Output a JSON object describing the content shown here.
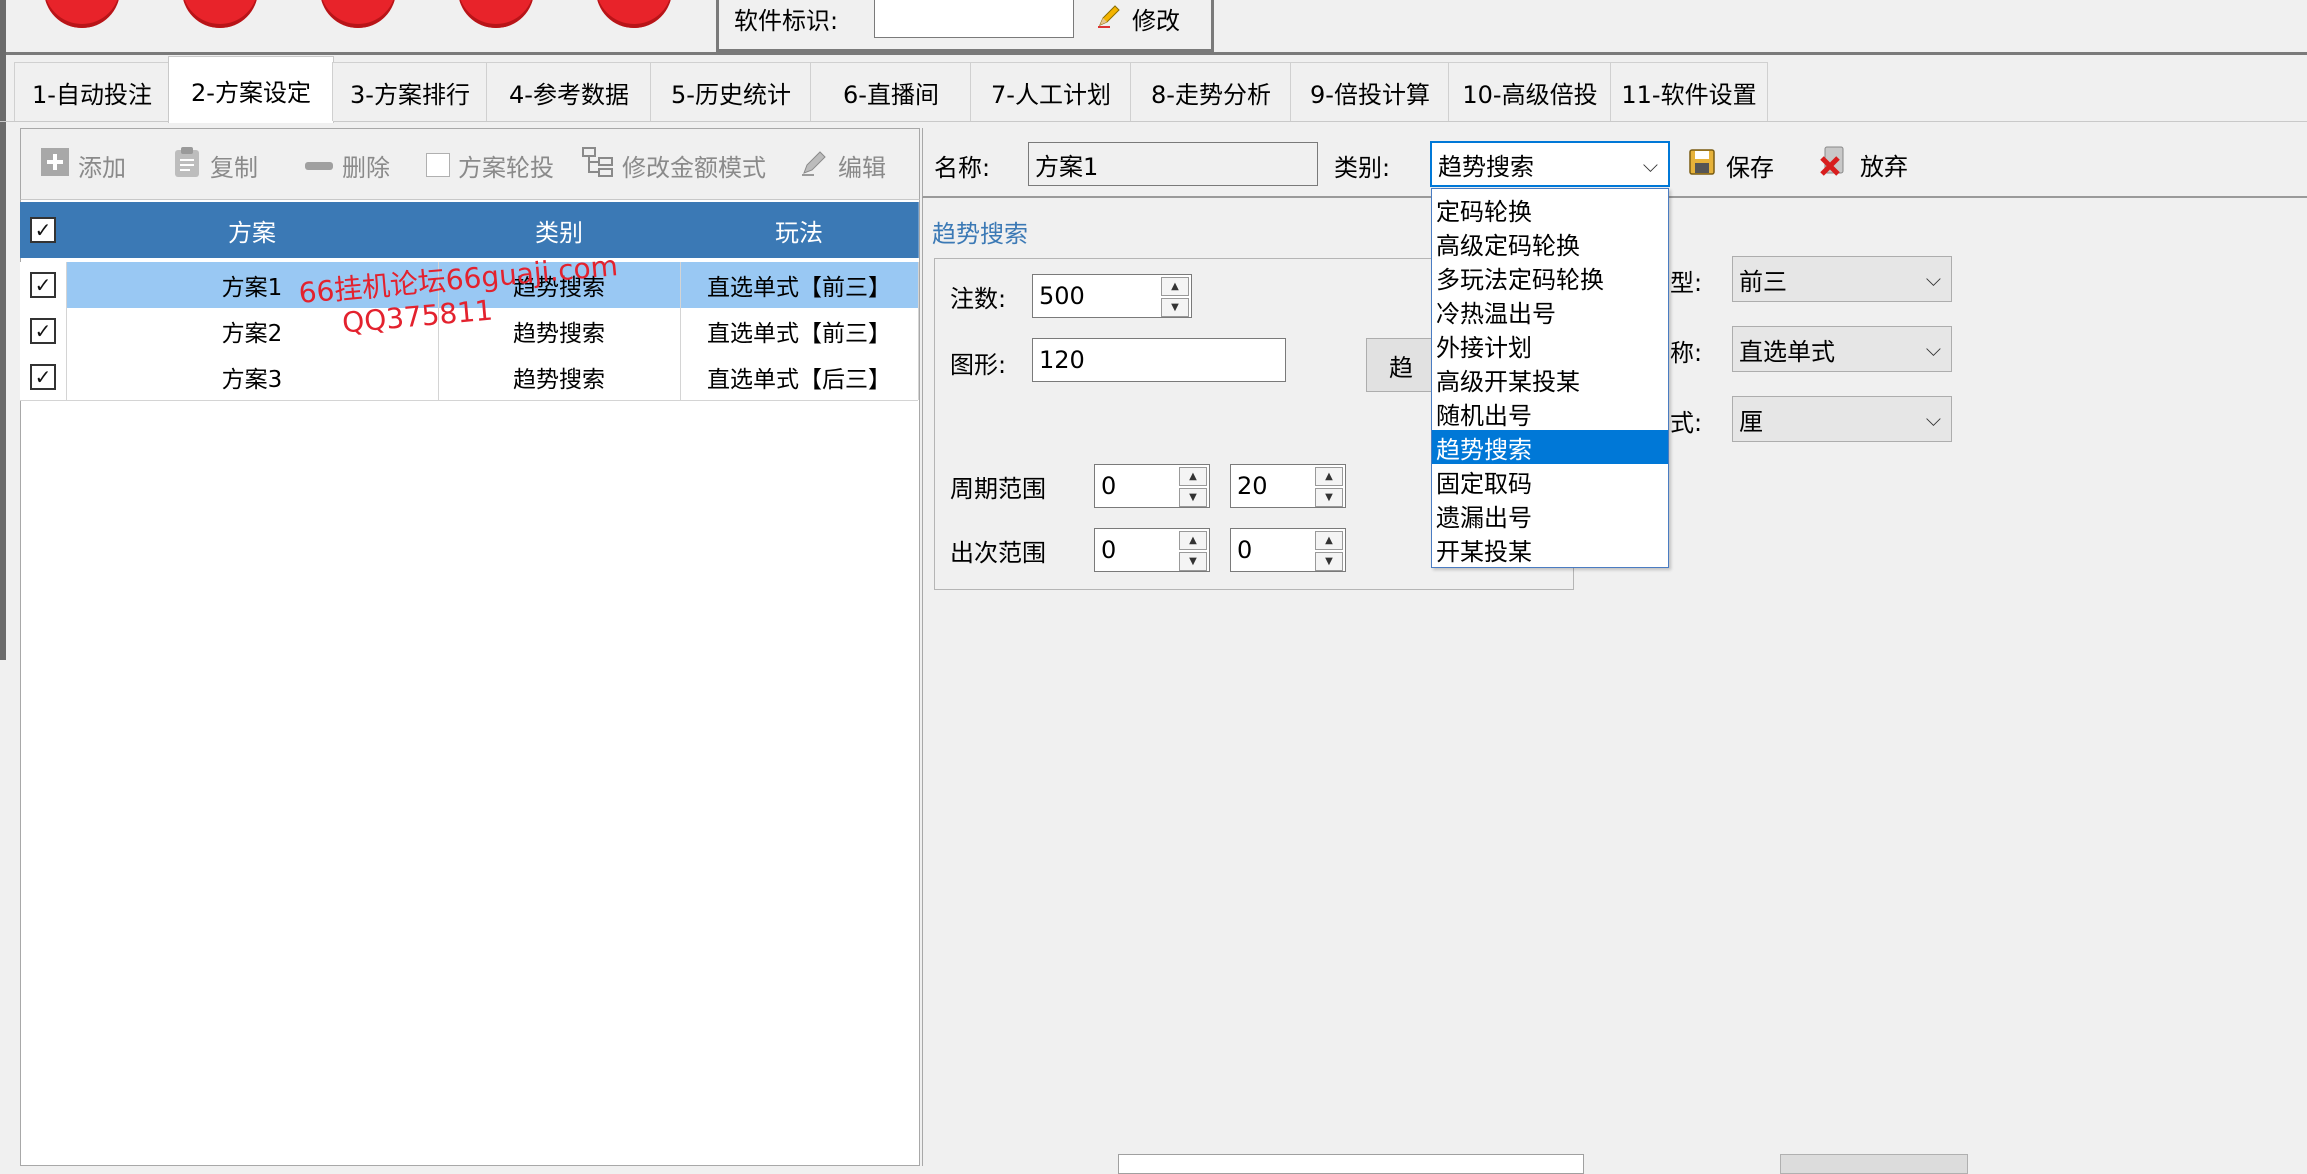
{
  "header": {
    "software_id_label": "软件标识:",
    "software_id_value": "",
    "modify_label": "修改"
  },
  "tabs": [
    {
      "label": "1-自动投注"
    },
    {
      "label": "2-方案设定"
    },
    {
      "label": "3-方案排行"
    },
    {
      "label": "4-参考数据"
    },
    {
      "label": "5-历史统计"
    },
    {
      "label": "6-直播间"
    },
    {
      "label": "7-人工计划"
    },
    {
      "label": "8-走势分析"
    },
    {
      "label": "9-倍投计算"
    },
    {
      "label": "10-高级倍投"
    },
    {
      "label": "11-软件设置"
    }
  ],
  "toolbar": {
    "add": "添加",
    "copy": "复制",
    "delete": "删除",
    "rotate": "方案轮投",
    "amount_mode": "修改金额模式",
    "edit": "编辑"
  },
  "grid": {
    "columns": [
      "方案",
      "类别",
      "玩法"
    ],
    "rows": [
      {
        "name": "方案1",
        "category": "趋势搜索",
        "play": "直选单式【前三】"
      },
      {
        "name": "方案2",
        "category": "趋势搜索",
        "play": "直选单式【前三】"
      },
      {
        "name": "方案3",
        "category": "趋势搜索",
        "play": "直选单式【后三】"
      }
    ]
  },
  "watermark": {
    "line1": "66挂机论坛66guaji.com",
    "line2": "QQ375811"
  },
  "editor": {
    "name_label": "名称:",
    "name_value": "方案1",
    "category_label": "类别:",
    "category_value": "趋势搜索",
    "save": "保存",
    "discard": "放弃",
    "section_title": "趋势搜索",
    "bets_label": "注数:",
    "bets_value": "500",
    "shape_label": "图形:",
    "shape_value": "120",
    "cut_button": "趋",
    "period_label": "周期范围",
    "period_from": "0",
    "period_to": "20",
    "hits_label": "出次范围",
    "hits_from": "0",
    "hits_to": "0",
    "type_label_partial": "型:",
    "type_value": "前三",
    "playname_label_partial": "称:",
    "playname_value": "直选单式",
    "mode_label_partial": "式:",
    "mode_value": "厘"
  },
  "dropdown": {
    "items": [
      "定码轮换",
      "高级定码轮换",
      "多玩法定码轮换",
      "冷热温出号",
      "外接计划",
      "高级开某投某",
      "随机出号",
      "趋势搜索",
      "固定取码",
      "遗漏出号",
      "开某投某"
    ],
    "selected": "趋势搜索"
  },
  "colors": {
    "grid_header": "#3b79b5",
    "row_selected": "#99c8f3",
    "dropdown_selected": "#0078d7",
    "watermark": "#e3222e",
    "section_title": "#3b79b5"
  }
}
